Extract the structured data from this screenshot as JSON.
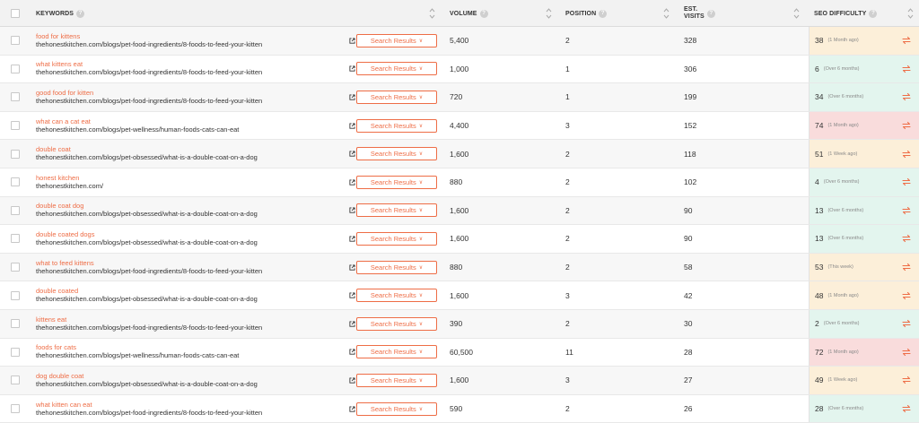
{
  "header": {
    "keywords": "KEYWORDS",
    "volume": "VOLUME",
    "position": "POSITION",
    "visits_line1": "EST.",
    "visits_line2": "VISITS",
    "seo_difficulty": "SEO DIFFICULTY",
    "help": "?"
  },
  "search_results_label": "Search Results",
  "colors": {
    "accent": "#ee6d46",
    "sd_easy": "#e3f5ee",
    "sd_medium": "#fcefd9",
    "sd_hard": "#f9dcdc"
  },
  "rows": [
    {
      "keyword": "food for kittens",
      "url": "thehonestkitchen.com/blogs/pet-food-ingredients/8-foods-to-feed-your-kitten",
      "volume": "5,400",
      "position": "2",
      "visits": "328",
      "sd": "38",
      "sd_time": "(1 Month ago)",
      "sd_level": "medium"
    },
    {
      "keyword": "what kittens eat",
      "url": "thehonestkitchen.com/blogs/pet-food-ingredients/8-foods-to-feed-your-kitten",
      "volume": "1,000",
      "position": "1",
      "visits": "306",
      "sd": "6",
      "sd_time": "(Over 6 months)",
      "sd_level": "easy"
    },
    {
      "keyword": "good food for kitten",
      "url": "thehonestkitchen.com/blogs/pet-food-ingredients/8-foods-to-feed-your-kitten",
      "volume": "720",
      "position": "1",
      "visits": "199",
      "sd": "34",
      "sd_time": "(Over 6 months)",
      "sd_level": "easy"
    },
    {
      "keyword": "what can a cat eat",
      "url": "thehonestkitchen.com/blogs/pet-wellness/human-foods-cats-can-eat",
      "volume": "4,400",
      "position": "3",
      "visits": "152",
      "sd": "74",
      "sd_time": "(1 Month ago)",
      "sd_level": "hard"
    },
    {
      "keyword": "double coat",
      "url": "thehonestkitchen.com/blogs/pet-obsessed/what-is-a-double-coat-on-a-dog",
      "volume": "1,600",
      "position": "2",
      "visits": "118",
      "sd": "51",
      "sd_time": "(1 Week ago)",
      "sd_level": "medium"
    },
    {
      "keyword": "honest kitchen",
      "url": "thehonestkitchen.com/",
      "volume": "880",
      "position": "2",
      "visits": "102",
      "sd": "4",
      "sd_time": "(Over 6 months)",
      "sd_level": "easy"
    },
    {
      "keyword": "double coat dog",
      "url": "thehonestkitchen.com/blogs/pet-obsessed/what-is-a-double-coat-on-a-dog",
      "volume": "1,600",
      "position": "2",
      "visits": "90",
      "sd": "13",
      "sd_time": "(Over 6 months)",
      "sd_level": "easy"
    },
    {
      "keyword": "double coated dogs",
      "url": "thehonestkitchen.com/blogs/pet-obsessed/what-is-a-double-coat-on-a-dog",
      "volume": "1,600",
      "position": "2",
      "visits": "90",
      "sd": "13",
      "sd_time": "(Over 6 months)",
      "sd_level": "easy"
    },
    {
      "keyword": "what to feed kittens",
      "url": "thehonestkitchen.com/blogs/pet-food-ingredients/8-foods-to-feed-your-kitten",
      "volume": "880",
      "position": "2",
      "visits": "58",
      "sd": "53",
      "sd_time": "(This week)",
      "sd_level": "medium"
    },
    {
      "keyword": "double coated",
      "url": "thehonestkitchen.com/blogs/pet-obsessed/what-is-a-double-coat-on-a-dog",
      "volume": "1,600",
      "position": "3",
      "visits": "42",
      "sd": "48",
      "sd_time": "(1 Month ago)",
      "sd_level": "medium"
    },
    {
      "keyword": "kittens eat",
      "url": "thehonestkitchen.com/blogs/pet-food-ingredients/8-foods-to-feed-your-kitten",
      "volume": "390",
      "position": "2",
      "visits": "30",
      "sd": "2",
      "sd_time": "(Over 6 months)",
      "sd_level": "easy"
    },
    {
      "keyword": "foods for cats",
      "url": "thehonestkitchen.com/blogs/pet-wellness/human-foods-cats-can-eat",
      "volume": "60,500",
      "position": "11",
      "visits": "28",
      "sd": "72",
      "sd_time": "(1 Month ago)",
      "sd_level": "hard"
    },
    {
      "keyword": "dog double coat",
      "url": "thehonestkitchen.com/blogs/pet-obsessed/what-is-a-double-coat-on-a-dog",
      "volume": "1,600",
      "position": "3",
      "visits": "27",
      "sd": "49",
      "sd_time": "(1 Week ago)",
      "sd_level": "medium"
    },
    {
      "keyword": "what kitten can eat",
      "url": "thehonestkitchen.com/blogs/pet-food-ingredients/8-foods-to-feed-your-kitten",
      "volume": "590",
      "position": "2",
      "visits": "26",
      "sd": "28",
      "sd_time": "(Over 6 months)",
      "sd_level": "easy"
    }
  ]
}
